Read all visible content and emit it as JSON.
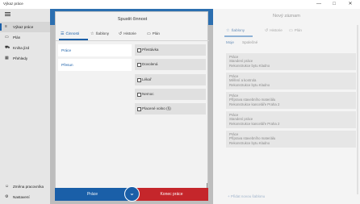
{
  "window": {
    "title": "Výkaz práce",
    "minimize_icon": "—",
    "maximize_icon": "□",
    "close_icon": "✕"
  },
  "sidebar": {
    "menu_icon": "hamburger-icon",
    "items": [
      {
        "label": "Výkaz práce",
        "icon": "≡",
        "selected": true
      },
      {
        "label": "Plán",
        "icon": "▭"
      },
      {
        "label": "Kniha jízd",
        "icon": "⛟"
      },
      {
        "label": "Přehledy",
        "icon": "▦"
      }
    ],
    "bottom": [
      {
        "label": "Změna pracovníka",
        "icon": "☺"
      },
      {
        "label": "Nastavení",
        "icon": "⚙"
      }
    ]
  },
  "modal": {
    "title": "Spustit činnost",
    "tabs": [
      {
        "label": "Činnosti",
        "icon": "☰",
        "active": true
      },
      {
        "label": "Šablony",
        "icon": "☆"
      },
      {
        "label": "Historie",
        "icon": "↺"
      },
      {
        "label": "Plán",
        "icon": "▭"
      }
    ],
    "categories": [
      "Práce",
      "Přesun"
    ],
    "activities": [
      "Přestávka",
      "Dovolená",
      "Lékař",
      "Nemoc",
      "Placené volno (§)"
    ],
    "buttons": {
      "work": "Práce",
      "toggle_icon": "⌄",
      "end_work": "Konec práce"
    }
  },
  "right_panel": {
    "title": "Nový záznam",
    "tabs": [
      {
        "label": "Šablony",
        "icon": "☆",
        "active": true
      },
      {
        "label": "Historie",
        "icon": "↺"
      },
      {
        "label": "Plán",
        "icon": "▭"
      }
    ],
    "subtabs": [
      {
        "label": "Moje",
        "active": true
      },
      {
        "label": "Společné"
      }
    ],
    "templates": [
      {
        "line1": "Práce",
        "line2": "Standení práce",
        "line3": "Rekonstrukce bytu Kladno"
      },
      {
        "line1": "Práce",
        "line2": "Měření a kontrola",
        "line3": "Rekonstrukce bytu Kladno"
      },
      {
        "line1": "Práce",
        "line2": "Příprava stavebního materiálu",
        "line3": "Rekonstrukce kanceláře Praha 2"
      },
      {
        "line1": "Práce",
        "line2": "Standení práce",
        "line3": "Rekonstrukce kanceláře Praha 2"
      },
      {
        "line1": "Práce",
        "line2": "Příprava stavebního materiálu",
        "line3": "Rekonstrukce bytu Kladno"
      }
    ],
    "add_template": "+  Přidat novou šablonu"
  }
}
